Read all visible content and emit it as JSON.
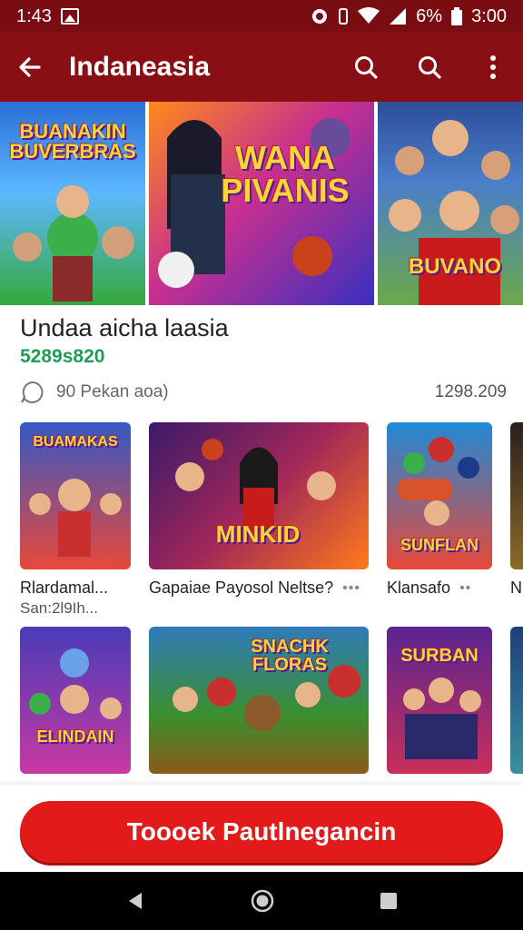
{
  "status_bar": {
    "time_left": "1:43",
    "battery_text": "6%",
    "time_right": "3:00"
  },
  "app_bar": {
    "title": "Indaneasia"
  },
  "hero": [
    {
      "title": "BUANAKIN\nBUVERBRAS",
      "bg": "#2a6fd6",
      "accent": "#36a83a"
    },
    {
      "title": "WANA\nPIVANIS",
      "bg": "#7a2fbf",
      "accent": "#ff7a1a"
    },
    {
      "title": "BUVANO",
      "bg": "#2d4e9a",
      "accent": "#c91b1b"
    }
  ],
  "detail": {
    "name": "Undaa aicha laasia",
    "price": "5289s820",
    "meta_text": "90 Pekan aoa)",
    "count": "1298.209"
  },
  "row1": [
    {
      "title": "Rlardamal...",
      "subtitle": "San:2l9Ih...",
      "art": "BUAMAKAS",
      "bg": "#3558c4"
    },
    {
      "title": "Gapaiae Payosol Neltse?",
      "art": "MINKID",
      "bg": "#6a1e7a"
    },
    {
      "title": "Klansafo",
      "art": "SUNFLAN",
      "bg": "#1f8ad6"
    },
    {
      "title": "N",
      "art": "",
      "bg": "#2b1f1f"
    }
  ],
  "row2": [
    {
      "art": "ELINDAIN",
      "bg": "#4a3bb8"
    },
    {
      "art": "SNACHK FLORAS",
      "bg": "#3b8f2f"
    },
    {
      "art": "SURBAN",
      "bg": "#5a2590"
    },
    {
      "art": "",
      "bg": "#1f3f7a"
    }
  ],
  "cta": {
    "label": "Toooek Pautlnegancin"
  },
  "colors": {
    "brand": "#8a0f15",
    "price": "#1e9e55",
    "cta": "#e21a1a"
  }
}
